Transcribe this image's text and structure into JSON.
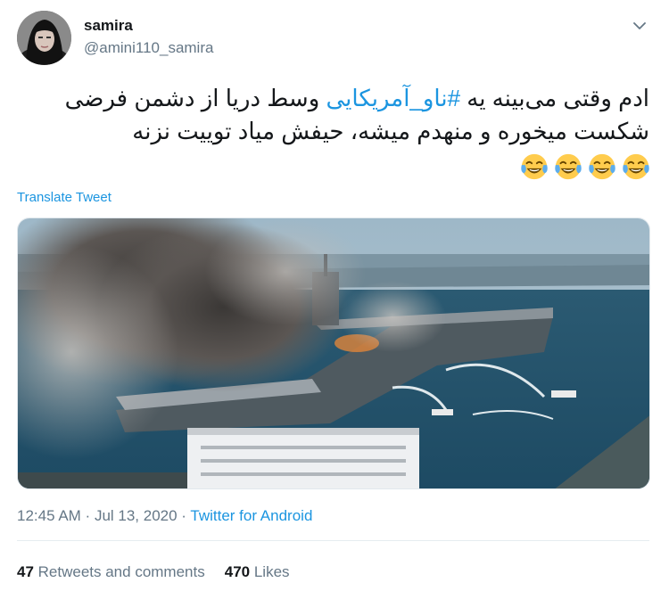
{
  "user": {
    "display_name": "samira",
    "handle": "@amini110_samira"
  },
  "tweet": {
    "text_before": "ادم وقتی می‌بینه یه ",
    "hashtag": "#ناو_آمریکایی",
    "text_after": " وسط دریا از دشمن فرضی شکست میخوره و منهدم میشه، حیفش میاد توییت نزنه",
    "emoji": [
      "face-with-tears-of-joy",
      "face-with-tears-of-joy",
      "face-with-tears-of-joy",
      "face-with-tears-of-joy"
    ],
    "translate_label": "Translate Tweet",
    "media_description_icon": "ship-fire-photo"
  },
  "meta": {
    "time": "12:45 AM",
    "separator": " · ",
    "date": "Jul 13, 2020",
    "separator2": " · ",
    "source": "Twitter for Android"
  },
  "stats": {
    "retweets_count": "47",
    "retweets_label": " Retweets and comments",
    "likes_count": "470",
    "likes_label": " Likes"
  },
  "colors": {
    "link": "#1b95e0",
    "secondary": "#657786",
    "primary": "#14171a"
  }
}
